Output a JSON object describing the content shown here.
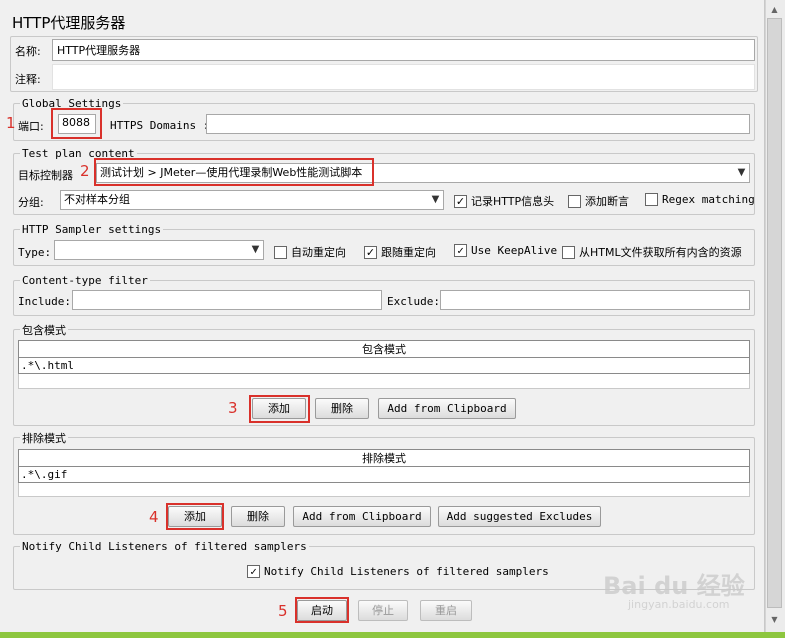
{
  "title": "HTTP代理服务器",
  "name": {
    "label": "名称:",
    "value": "HTTP代理服务器"
  },
  "comment": {
    "label": "注释:",
    "value": ""
  },
  "global": {
    "legend": "Global Settings",
    "port_label": "端口:",
    "port_value": "8088",
    "https_label": "HTTPS Domains :",
    "https_value": ""
  },
  "test_plan": {
    "legend": "Test plan content",
    "target_label": "目标控制器",
    "target_value": "测试计划 > JMeter—使用代理录制Web性能测试脚本",
    "group_label": "分组:",
    "group_value": "不对样本分组",
    "record_headers": "记录HTTP信息头",
    "add_assertions": "添加断言",
    "regex_matching": "Regex matching"
  },
  "sampler": {
    "legend": "HTTP Sampler settings",
    "type_label": "Type:",
    "type_value": "",
    "auto_redirect": "自动重定向",
    "follow_redirect": "跟随重定向",
    "keepalive": "Use KeepAlive",
    "fetch_resources": "从HTML文件获取所有内含的资源"
  },
  "content_filter": {
    "legend": "Content-type filter",
    "include_label": "Include:",
    "include_value": "",
    "exclude_label": "Exclude:",
    "exclude_value": ""
  },
  "include_patterns": {
    "legend": "包含模式",
    "column": "包含模式",
    "rows": [
      ".*\\.html"
    ],
    "add": "添加",
    "delete": "删除",
    "clipboard": "Add from Clipboard"
  },
  "exclude_patterns": {
    "legend": "排除模式",
    "column": "排除模式",
    "rows": [
      ".*\\.gif"
    ],
    "add": "添加",
    "delete": "删除",
    "clipboard": "Add from Clipboard",
    "suggested": "Add suggested Excludes"
  },
  "notify": {
    "legend": "Notify Child Listeners of filtered samplers",
    "checkbox": "Notify Child Listeners of filtered samplers"
  },
  "actions": {
    "start": "启动",
    "stop": "停止",
    "restart": "重启"
  },
  "annotations": [
    "1",
    "2",
    "3",
    "4",
    "5"
  ],
  "watermark": {
    "logo": "Bai du 经验",
    "url": "jingyan.baidu.com"
  },
  "colors": {
    "annotation": "#d9312b",
    "panel": "#f0f0f0",
    "bottom_bar": "#8dc63f"
  }
}
